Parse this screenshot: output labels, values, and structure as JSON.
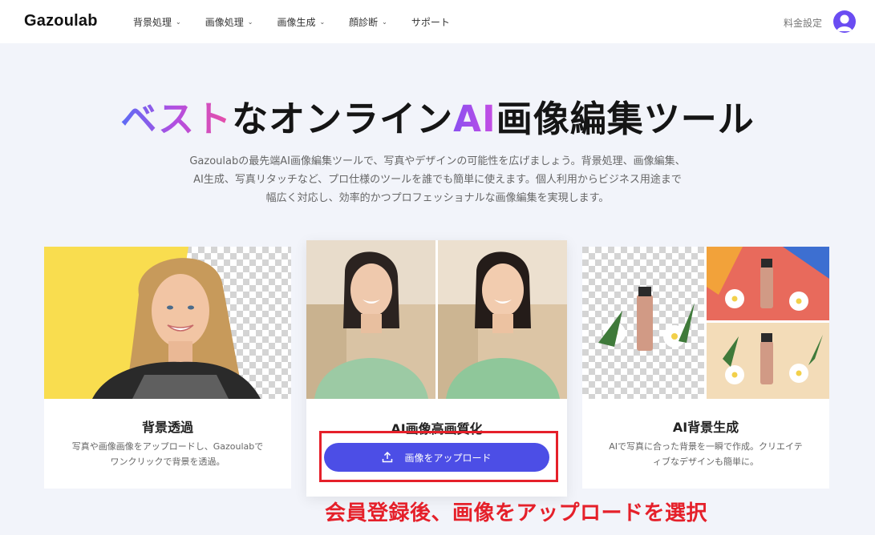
{
  "header": {
    "logo": "Gazoulab",
    "nav": [
      {
        "label": "背景処理",
        "has_dropdown": true
      },
      {
        "label": "画像処理",
        "has_dropdown": true
      },
      {
        "label": "画像生成",
        "has_dropdown": true
      },
      {
        "label": "顔診断",
        "has_dropdown": true
      },
      {
        "label": "サポート",
        "has_dropdown": false
      }
    ],
    "pricing": "料金設定",
    "avatar_icon": "user-avatar-icon"
  },
  "hero": {
    "title_part1": "ベスト",
    "title_part2": "なオンライン",
    "title_part3": "AI",
    "title_part4": "画像編集ツール",
    "description_lines": [
      "Gazoulabの最先端AI画像編集ツールで、写真やデザインの可能性を広げましょう。背景処理、画像編集、",
      "AI生成、写真リタッチなど、プロ仕様のツールを誰でも簡単に使えます。個人利用からビジネス用途まで",
      "幅広く対応し、効率的かつプロフェッショナルな画像編集を実現します。"
    ]
  },
  "cards": [
    {
      "title": "背景透過",
      "description_lines": [
        "写真や画像画像をアップロードし、Gazoulabで",
        "ワンクリックで背景を透過。"
      ]
    },
    {
      "title": "AI画像高画質化",
      "button_label": "画像をアップロード",
      "button_icon": "upload-icon"
    },
    {
      "title": "AI背景生成",
      "description_lines": [
        "AIで写真に合った背景を一瞬で作成。クリエイテ",
        "ィブなデザインも簡単に。"
      ]
    }
  ],
  "annotation": "会員登録後、画像をアップロードを選択",
  "colors": {
    "accent": "#4c4ee6",
    "annotation_red": "#e5202a",
    "page_bg": "#f2f4fa"
  }
}
